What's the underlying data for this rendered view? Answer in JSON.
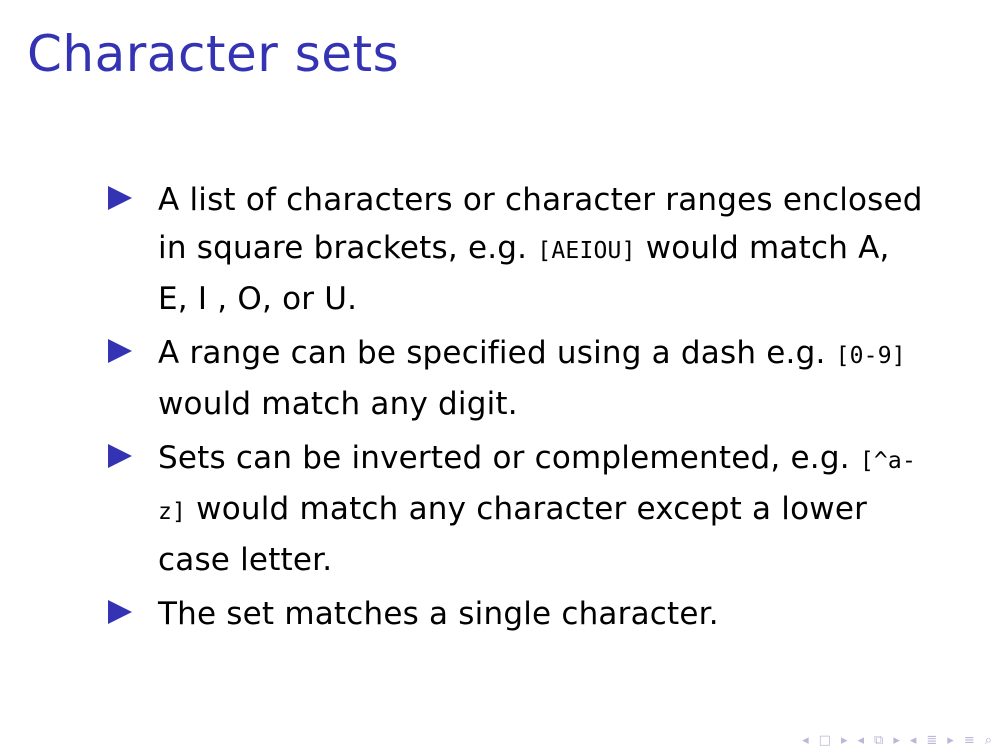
{
  "slide": {
    "title": "Character sets",
    "bullets": [
      {
        "before": "A list of characters or character ranges enclosed in square brackets, e.g. ",
        "code": "[AEIOU]",
        "after": " would match A, E, I , O, or U."
      },
      {
        "before": "A range can be specified using a dash e.g. ",
        "code": "[0-9]",
        "after": " would match any digit."
      },
      {
        "before": "Sets can be inverted or complemented, e.g. ",
        "code": "[^a-z]",
        "after": " would match any character except a lower case letter."
      },
      {
        "text": "The set matches a single character."
      }
    ]
  },
  "colors": {
    "title": "#3333b3",
    "bullet_marker": "#3333b3",
    "nav_icons": "#b8b8d9"
  },
  "navigation": {
    "icons": [
      "frame-prev-icon",
      "frame-icon",
      "frame-next-icon",
      "subsection-prev-icon",
      "subsection-icon",
      "subsection-next-icon",
      "section-prev-icon",
      "section-icon",
      "section-next-icon",
      "align-icon",
      "search-icon"
    ]
  }
}
